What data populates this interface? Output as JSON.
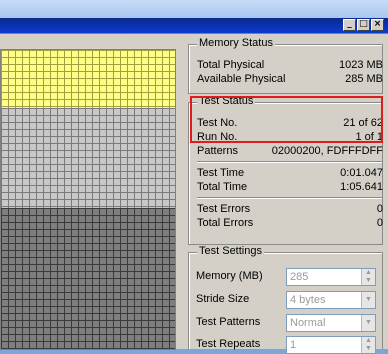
{
  "window": {
    "minimize": "_",
    "maximize": "□",
    "close": "×"
  },
  "memory_status": {
    "title": "Memory Status",
    "rows": [
      {
        "label": "Total Physical",
        "value": "1023 MB"
      },
      {
        "label": "Available Physical",
        "value": "285 MB"
      }
    ]
  },
  "test_status": {
    "title": "Test Status",
    "rows": [
      {
        "label": "Test No.",
        "value": "21 of 62"
      },
      {
        "label": "Run No.",
        "value": "1 of 1"
      },
      {
        "label": "Patterns",
        "value": "02000200, FDFFFDFF"
      },
      {
        "label": "Test Time",
        "value": "0:01.047"
      },
      {
        "label": "Total Time",
        "value": "1:05.641"
      },
      {
        "label": "Test Errors",
        "value": "0"
      },
      {
        "label": "Total Errors",
        "value": "0"
      }
    ]
  },
  "test_settings": {
    "title": "Test Settings",
    "memory_label": "Memory (MB)",
    "memory_value": "285",
    "stride_label": "Stride Size",
    "stride_value": "4 bytes",
    "patterns_label": "Test Patterns",
    "patterns_value": "Normal",
    "repeats_label": "Test Repeats",
    "repeats_value": "1"
  },
  "colors": {
    "highlight": "#e01b1b",
    "tested_block": "#ffff88",
    "pending_block": "#c8c8c8",
    "untested_block": "#7e7e7e"
  }
}
